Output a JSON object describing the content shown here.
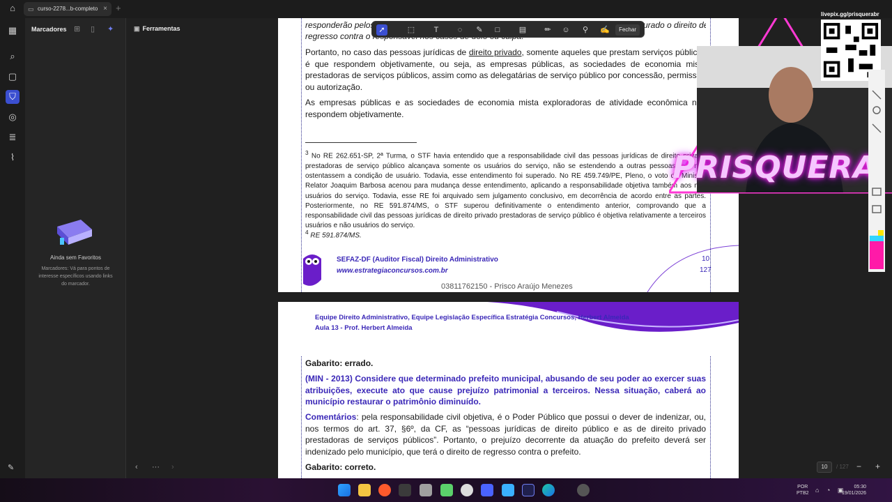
{
  "app": {
    "tab_title": "curso-2278...b-completo",
    "tab_close": "×",
    "tab_add": "+"
  },
  "sidebar": {
    "panel_title": "Marcadores",
    "tools_label": "Ferramentas",
    "empty_title": "Ainda sem Favoritos",
    "empty_desc": "Marcadores: Vá para pontos de interesse específicos usando links do marcador."
  },
  "toolbar": {
    "close_label": "Fechar"
  },
  "document": {
    "page1": {
      "top_fragment_1": "responderão pelos danos que seus agentes, nessa qualidade, causarem a terceiros, assegurado o direito de",
      "top_fragment_2": "regresso contra o responsável nos casos de dolo ou culpa.",
      "para1_prefix": "Portanto, no caso das pessoas jurídicas de ",
      "para1_link": "direito privado",
      "para1_rest": ", somente aqueles que prestam serviços públicos é que respondem objetivamente, ou seja, as empresas públicas, as sociedades de economia mista prestadoras de serviços públicos, assim como as delegatárias de serviço público por concessão, permissão ou autorização.",
      "para2": "As empresas públicas e as sociedades de economia mista exploradoras de atividade econômica não respondem objetivamente.",
      "footnote3_num": "3",
      "footnote3": "No RE 262.651-SP, 2ª Turma, o STF havia entendido que a responsabilidade civil das pessoas jurídicas de direito privado prestadoras de serviço público alcançava somente os usuários do serviço, não se estendendo a outras pessoas que não ostentassem a condição de usuário. Todavia, esse entendimento foi superado. No RE 459.749/PE, Pleno, o voto do Ministro Relator Joaquim Barbosa acenou para mudança desse entendimento, aplicando a responsabilidade objetiva também aos não usuários do serviço. Todavia, esse RE foi arquivado sem julgamento conclusivo, em decorrência de acordo entre as partes. Posteriormente, no RE 591.874/MS, o STF superou definitivamente o entendimento anterior, comprovando que a responsabilidade civil das pessoas jurídicas de direito privado prestadoras de serviço público é objetiva relativamente a terceiros usuários e não usuários do serviço.",
      "footnote4_num": "4",
      "footnote4": "RE 591.874/MS.",
      "footer_course": "SEFAZ-DF (Auditor Fiscal) Direito Administrativo",
      "footer_site": "www.estrategiaconcursos.com.br",
      "footer_owner": "03811762150 - Prisco Araújo Menezes",
      "page_num": "10",
      "page_total": "127"
    },
    "page2": {
      "header_line1": "Equipe Direito Administrativo, Equipe Legislação Específica Estratégia Concursos, Herbert Almeida",
      "header_line2": "Aula 13 - Prof. Herbert Almeida",
      "gabarito1": "Gabarito: errado.",
      "question": "(MIN - 2013) Considere que determinado prefeito municipal, abusando de seu poder ao exercer suas atribuições, execute ato que cause prejuízo patrimonial a terceiros. Nessa situação, caberá ao município restaurar o patrimônio diminuído.",
      "comment_label": "Comentários",
      "comment_text": ": pela responsabilidade civil objetiva, é o Poder Público que possui o dever de indenizar, ou, nos termos do art. 37, §6º, da CF, as “pessoas jurídicas de direito público e as de direito privado prestadoras de serviços públicos”. Portanto, o prejuízo decorrente da atuação do prefeito deverá ser indenizado pelo município, que terá o direito de regresso contra o prefeito.",
      "gabarito2": "Gabarito: correto."
    }
  },
  "status": {
    "current_page": "10",
    "total_pages": "/ 127"
  },
  "overlay": {
    "qr_label": "livepix.gg/prisquerabr",
    "streamer_name": "PRISQUERA"
  },
  "taskbar": {
    "lang_1": "POR",
    "lang_2": "PTB2",
    "time": "05:30",
    "date": "19/01/2026"
  },
  "colors": {
    "accent": "#3b4fd0",
    "question_blue": "#3a27b7",
    "neon": "#ff39d4"
  }
}
